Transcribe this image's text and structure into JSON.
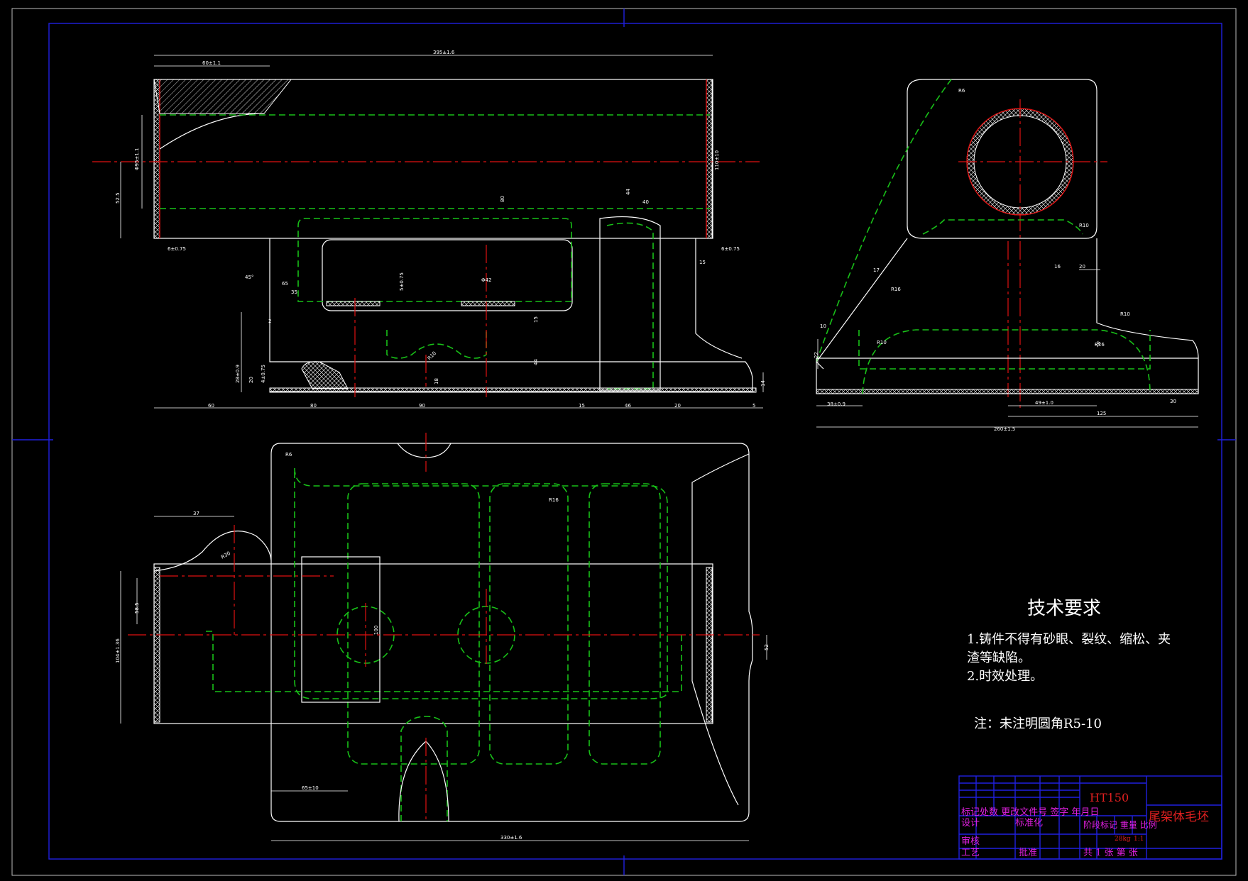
{
  "tech_requirements": {
    "heading": "技术要求",
    "lines": [
      "1.铸件不得有砂眼、裂纹、缩松、夹",
      "渣等缺陷。",
      "2.时效处理。"
    ],
    "note": "注：未注明圆角R5-10"
  },
  "title_block": {
    "material": "HT150",
    "part_name": "尾架体毛坯",
    "row_labels": "标记处数 更改文件号 签字 年月日",
    "design": "设计",
    "standardize": "标准化",
    "stage_mark": "阶段标记 重量 比例",
    "weight": "28kg",
    "scale": "1:1",
    "review": "审核",
    "process": "工艺",
    "approve": "批准",
    "sheets": "共 1 张 第 张"
  },
  "dimensions": {
    "front_total": "395±1.6",
    "front_left": "60±1.1",
    "front_dia": "Φ95±1.1",
    "front_h1": "52.5",
    "front_wall": "6±0.75",
    "front_wall_r": "6±0.75",
    "front_15": "15",
    "front_45": "45°",
    "front_65": "65",
    "front_35": "35",
    "front_2": "2",
    "front_5": "5±0.75",
    "front_phi42": "Φ42",
    "front_80": "80",
    "front_r10": "R10",
    "front_18": "18",
    "front_15b": "15",
    "front_44": "44",
    "front_44b": "44",
    "front_40": "40",
    "front_28": "28±0.9",
    "front_20": "20",
    "front_4": "4±0.75",
    "front_14": "14",
    "front_110": "110±10",
    "front_b60": "60",
    "front_b80": "80",
    "front_b90": "90",
    "front_b15": "15",
    "front_b46": "46",
    "front_b20": "20",
    "front_b5": "5",
    "side_r6": "R6",
    "side_r10": "R10",
    "side_r16": "R16",
    "side_r10b": "R10",
    "side_r16b": "R16",
    "side_r10c": "R10",
    "side_17": "17",
    "side_16": "16",
    "side_20": "20",
    "side_16b": "16",
    "side_10": "10",
    "side_22": "22",
    "side_38": "38±0.9",
    "side_49": "49±1.0",
    "side_30": "30",
    "side_125": "125",
    "side_total": "260±1.5",
    "top_r6": "R6",
    "top_r16": "R16",
    "top_37": "37",
    "top_r30": "R30",
    "top_58": "58.5",
    "top_104": "104±1.36",
    "top_100": "100",
    "top_52": "52",
    "top_65": "65±10",
    "top_total": "330±1.6"
  }
}
